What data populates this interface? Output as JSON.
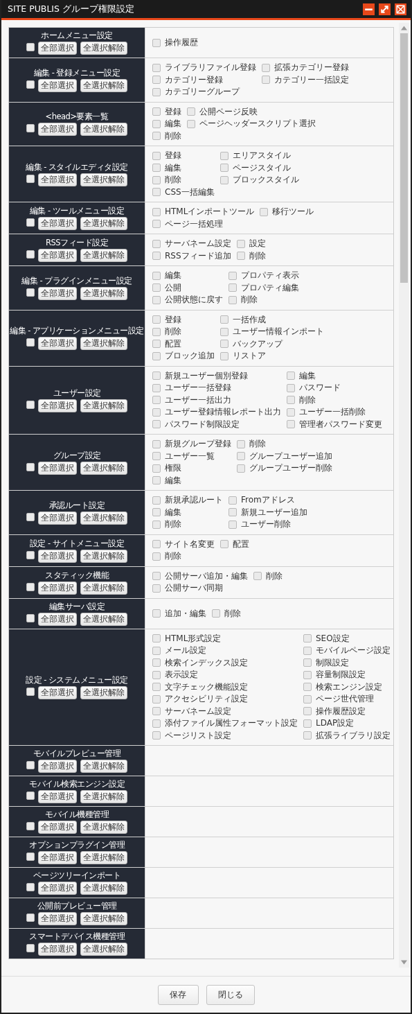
{
  "window": {
    "title": "SITE PUBLIS グループ権限設定"
  },
  "sections": [
    {
      "title": "ホームメニュー設定",
      "checked": false,
      "select_all": "全部選択",
      "clear_all": "全選択解除",
      "rows": [
        [
          {
            "label": "操作履歴",
            "checked": false
          }
        ]
      ]
    },
    {
      "title": "編集 - 登録メニュー設定",
      "checked": false,
      "select_all": "全部選択",
      "clear_all": "全選択解除",
      "rows": [
        [
          {
            "label": "ライブラリファイル登録",
            "checked": false
          },
          {
            "label": "拡張カテゴリー登録",
            "checked": false
          }
        ],
        [
          {
            "label": "カテゴリー登録",
            "checked": false
          },
          {
            "label": "カテゴリー一括設定",
            "checked": false
          }
        ],
        [
          {
            "label": "カテゴリーグループ",
            "checked": false
          }
        ]
      ]
    },
    {
      "title": "<head>要素一覧",
      "checked": false,
      "select_all": "全部選択",
      "clear_all": "全選択解除",
      "rows": [
        [
          {
            "label": "登録",
            "checked": false
          },
          {
            "label": "公開ページ反映",
            "checked": false
          }
        ],
        [
          {
            "label": "編集",
            "checked": false
          },
          {
            "label": "ページヘッダースクリプト選択",
            "checked": false
          }
        ],
        [
          {
            "label": "削除",
            "checked": false
          }
        ]
      ]
    },
    {
      "title": "編集 - スタイルエディタ設定",
      "checked": false,
      "select_all": "全部選択",
      "clear_all": "全選択解除",
      "rows": [
        [
          {
            "label": "登録",
            "checked": false
          },
          {
            "label": "エリアスタイル",
            "checked": false
          }
        ],
        [
          {
            "label": "編集",
            "checked": false
          },
          {
            "label": "ページスタイル",
            "checked": false
          }
        ],
        [
          {
            "label": "削除",
            "checked": false
          },
          {
            "label": "ブロックスタイル",
            "checked": false
          }
        ],
        [
          {
            "label": "CSS一括編集",
            "checked": false
          }
        ]
      ]
    },
    {
      "title": "編集 - ツールメニュー設定",
      "checked": false,
      "select_all": "全部選択",
      "clear_all": "全選択解除",
      "rows": [
        [
          {
            "label": "HTMLインポートツール",
            "checked": false
          },
          {
            "label": "移行ツール",
            "checked": false
          }
        ],
        [
          {
            "label": "ページ一括処理",
            "checked": false
          }
        ]
      ]
    },
    {
      "title": "RSSフィード設定",
      "checked": false,
      "select_all": "全部選択",
      "clear_all": "全選択解除",
      "rows": [
        [
          {
            "label": "サーバネーム設定",
            "checked": false
          },
          {
            "label": "設定",
            "checked": false
          }
        ],
        [
          {
            "label": "RSSフィード追加",
            "checked": false
          },
          {
            "label": "削除",
            "checked": false
          }
        ]
      ]
    },
    {
      "title": "編集 - プラグインメニュー設定",
      "checked": false,
      "select_all": "全部選択",
      "clear_all": "全選択解除",
      "rows": [
        [
          {
            "label": "編集",
            "checked": false
          },
          {
            "label": "プロパティ表示",
            "checked": false
          }
        ],
        [
          {
            "label": "公開",
            "checked": false
          },
          {
            "label": "プロパティ編集",
            "checked": false
          }
        ],
        [
          {
            "label": "公開状態に戻す",
            "checked": false
          },
          {
            "label": "削除",
            "checked": false
          }
        ]
      ]
    },
    {
      "title": "編集 - アプリケーションメニュー設定",
      "checked": false,
      "select_all": "全部選択",
      "clear_all": "全選択解除",
      "rows": [
        [
          {
            "label": "登録",
            "checked": false
          },
          {
            "label": "一括作成",
            "checked": false
          }
        ],
        [
          {
            "label": "削除",
            "checked": false
          },
          {
            "label": "ユーザー情報インポート",
            "checked": false
          }
        ],
        [
          {
            "label": "配置",
            "checked": false
          },
          {
            "label": "バックアップ",
            "checked": false
          }
        ],
        [
          {
            "label": "ブロック追加",
            "checked": false
          },
          {
            "label": "リストア",
            "checked": false
          }
        ]
      ]
    },
    {
      "title": "ユーザー設定",
      "checked": false,
      "select_all": "全部選択",
      "clear_all": "全選択解除",
      "rows": [
        [
          {
            "label": "新規ユーザー個別登録",
            "checked": false
          },
          {
            "label": "編集",
            "checked": false
          }
        ],
        [
          {
            "label": "ユーザー一括登録",
            "checked": false
          },
          {
            "label": "パスワード",
            "checked": false
          }
        ],
        [
          {
            "label": "ユーザー一括出力",
            "checked": false
          },
          {
            "label": "削除",
            "checked": false
          }
        ],
        [
          {
            "label": "ユーザー登録情報レポート出力",
            "checked": false
          },
          {
            "label": "ユーザー一括削除",
            "checked": false
          }
        ],
        [
          {
            "label": "パスワード制限設定",
            "checked": false
          },
          {
            "label": "管理者パスワード変更",
            "checked": false
          }
        ]
      ]
    },
    {
      "title": "グループ設定",
      "checked": false,
      "select_all": "全部選択",
      "clear_all": "全選択解除",
      "rows": [
        [
          {
            "label": "新規グループ登録",
            "checked": false
          },
          {
            "label": "削除",
            "checked": false
          }
        ],
        [
          {
            "label": "ユーザー一覧",
            "checked": false
          },
          {
            "label": "グループユーザー追加",
            "checked": false
          }
        ],
        [
          {
            "label": "権限",
            "checked": false
          },
          {
            "label": "グループユーザー削除",
            "checked": false
          }
        ],
        [
          {
            "label": "編集",
            "checked": false
          }
        ]
      ]
    },
    {
      "title": "承認ルート設定",
      "checked": false,
      "select_all": "全部選択",
      "clear_all": "全選択解除",
      "rows": [
        [
          {
            "label": "新規承認ルート",
            "checked": false
          },
          {
            "label": "Fromアドレス",
            "checked": false
          }
        ],
        [
          {
            "label": "編集",
            "checked": false
          },
          {
            "label": "新規ユーザー追加",
            "checked": false
          }
        ],
        [
          {
            "label": "削除",
            "checked": false
          },
          {
            "label": "ユーザー削除",
            "checked": false
          }
        ]
      ]
    },
    {
      "title": "設定 - サイトメニュー設定",
      "checked": false,
      "select_all": "全部選択",
      "clear_all": "全選択解除",
      "rows": [
        [
          {
            "label": "サイト名変更",
            "checked": false
          },
          {
            "label": "配置",
            "checked": false
          }
        ],
        [
          {
            "label": "削除",
            "checked": false
          }
        ]
      ]
    },
    {
      "title": "スタティック機能",
      "checked": false,
      "select_all": "全部選択",
      "clear_all": "全選択解除",
      "rows": [
        [
          {
            "label": "公開サーバ追加・編集",
            "checked": false
          },
          {
            "label": "削除",
            "checked": false
          }
        ],
        [
          {
            "label": "公開サーバ同期",
            "checked": false
          }
        ]
      ]
    },
    {
      "title": "編集サーバ設定",
      "checked": false,
      "select_all": "全部選択",
      "clear_all": "全選択解除",
      "rows": [
        [
          {
            "label": "追加・編集",
            "checked": false
          },
          {
            "label": "削除",
            "checked": false
          }
        ]
      ]
    },
    {
      "title": "設定 - システムメニュー設定",
      "checked": false,
      "select_all": "全部選択",
      "clear_all": "全選択解除",
      "rows": [
        [
          {
            "label": "HTML形式設定",
            "checked": false
          },
          {
            "label": "SEO設定",
            "checked": false
          }
        ],
        [
          {
            "label": "メール設定",
            "checked": false
          },
          {
            "label": "モバイルページ設定",
            "checked": false
          }
        ],
        [
          {
            "label": "検索インデックス設定",
            "checked": false
          },
          {
            "label": "制限設定",
            "checked": false
          }
        ],
        [
          {
            "label": "表示設定",
            "checked": false
          },
          {
            "label": "容量制限設定",
            "checked": false
          }
        ],
        [
          {
            "label": "文字チェック機能設定",
            "checked": false
          },
          {
            "label": "検索エンジン設定",
            "checked": false
          }
        ],
        [
          {
            "label": "アクセシビリティ設定",
            "checked": false
          },
          {
            "label": "ページ世代管理",
            "checked": false
          }
        ],
        [
          {
            "label": "サーバネーム設定",
            "checked": false
          },
          {
            "label": "操作履歴設定",
            "checked": false
          }
        ],
        [
          {
            "label": "添付ファイル属性フォーマット設定",
            "checked": false
          },
          {
            "label": "LDAP設定",
            "checked": false
          }
        ],
        [
          {
            "label": "ページリスト設定",
            "checked": false
          },
          {
            "label": "拡張ライブラリ設定",
            "checked": false
          }
        ]
      ]
    },
    {
      "title": "モバイルプレビュー管理",
      "checked": false,
      "select_all": "全部選択",
      "clear_all": "全選択解除"
    },
    {
      "title": "モバイル検索エンジン設定",
      "checked": false,
      "select_all": "全部選択",
      "clear_all": "全選択解除"
    },
    {
      "title": "モバイル機種管理",
      "checked": false,
      "select_all": "全部選択",
      "clear_all": "全選択解除"
    },
    {
      "title": "オプションプラグイン管理",
      "checked": false,
      "select_all": "全部選択",
      "clear_all": "全選択解除"
    },
    {
      "title": "ページツリーインポート",
      "checked": false,
      "select_all": "全部選択",
      "clear_all": "全選択解除"
    },
    {
      "title": "公開前プレビュー管理",
      "checked": false,
      "select_all": "全部選択",
      "clear_all": "全選択解除"
    },
    {
      "title": "スマートデバイス機種管理",
      "checked": false,
      "select_all": "全部選択",
      "clear_all": "全選択解除"
    }
  ],
  "buttons": [
    "保存",
    "閉じる"
  ]
}
